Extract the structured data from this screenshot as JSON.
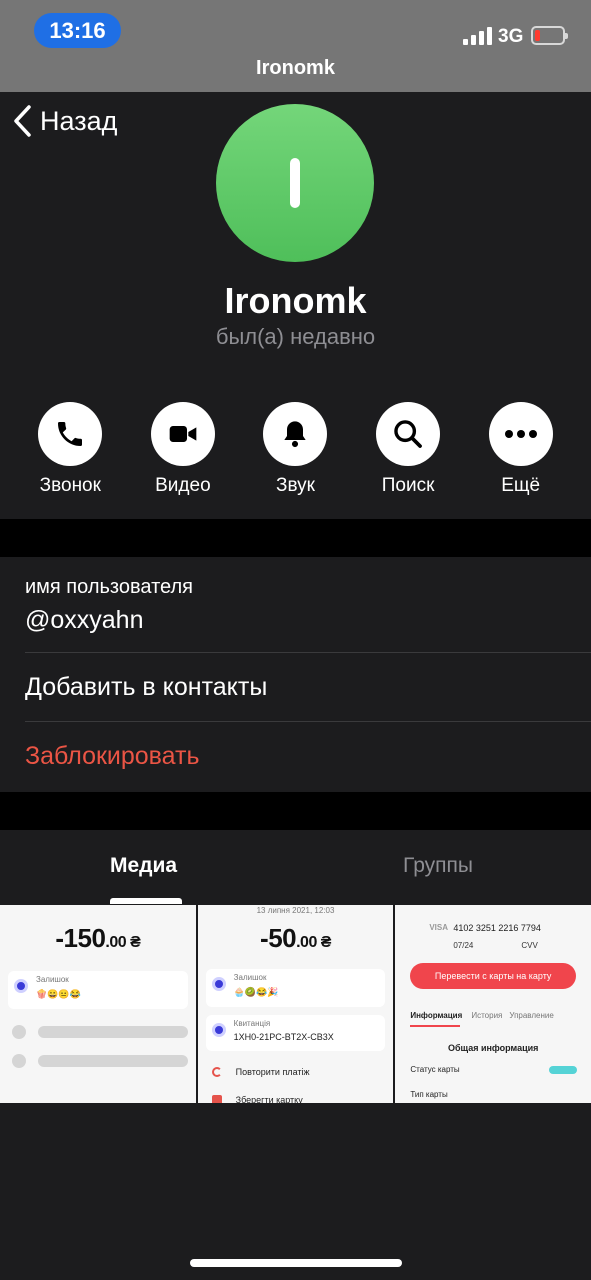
{
  "status_bar": {
    "time": "13:16",
    "network": "3G",
    "battery_color": "#ff3b30"
  },
  "nav": {
    "title": "Ironomk",
    "back_label": "Назад"
  },
  "profile": {
    "name": "Ironomk",
    "status": "был(а) недавно",
    "avatar_letter": "I",
    "avatar_color": "#5ccb64"
  },
  "actions": [
    {
      "label": "Звонок",
      "icon": "phone-icon"
    },
    {
      "label": "Видео",
      "icon": "video-icon"
    },
    {
      "label": "Звук",
      "icon": "bell-icon"
    },
    {
      "label": "Поиск",
      "icon": "search-icon"
    },
    {
      "label": "Ещё",
      "icon": "more-icon"
    }
  ],
  "info": {
    "username_label": "имя пользователя",
    "username": "@oxxyahn",
    "add_contact": "Добавить в контакты",
    "block": "Заблокировать",
    "block_color": "#eb5545"
  },
  "tabs": {
    "media": "Медиа",
    "groups": "Группы"
  },
  "media": {
    "thumb1": {
      "amount": "-150",
      "cents": ".00 ₴",
      "balance_label": "Залишок",
      "emojis": "🍿😀😐😂"
    },
    "thumb2": {
      "date": "13 липня 2021, 12:03",
      "amount": "-50",
      "cents": ".00 ₴",
      "balance_label": "Залишок",
      "emojis": "🧁🥝😂🎉",
      "receipt_label": "Квитанція",
      "receipt_code": "1XH0-21PC-BT2X-CB3X",
      "repeat_label": "Повторити платіж",
      "save_label": "Зберегти картку"
    },
    "thumb3": {
      "card_brand": "VISA",
      "card_number": "4102  3251  2216  7794",
      "expiry": "07/24",
      "cvv": "CVV",
      "transfer_button": "Перевести с карты на карту",
      "tab_info": "Информация",
      "tab_history": "История",
      "tab_manage": "Управление",
      "section_title": "Общая информация",
      "status_label": "Статус карты",
      "type_label": "Тип карты"
    }
  }
}
